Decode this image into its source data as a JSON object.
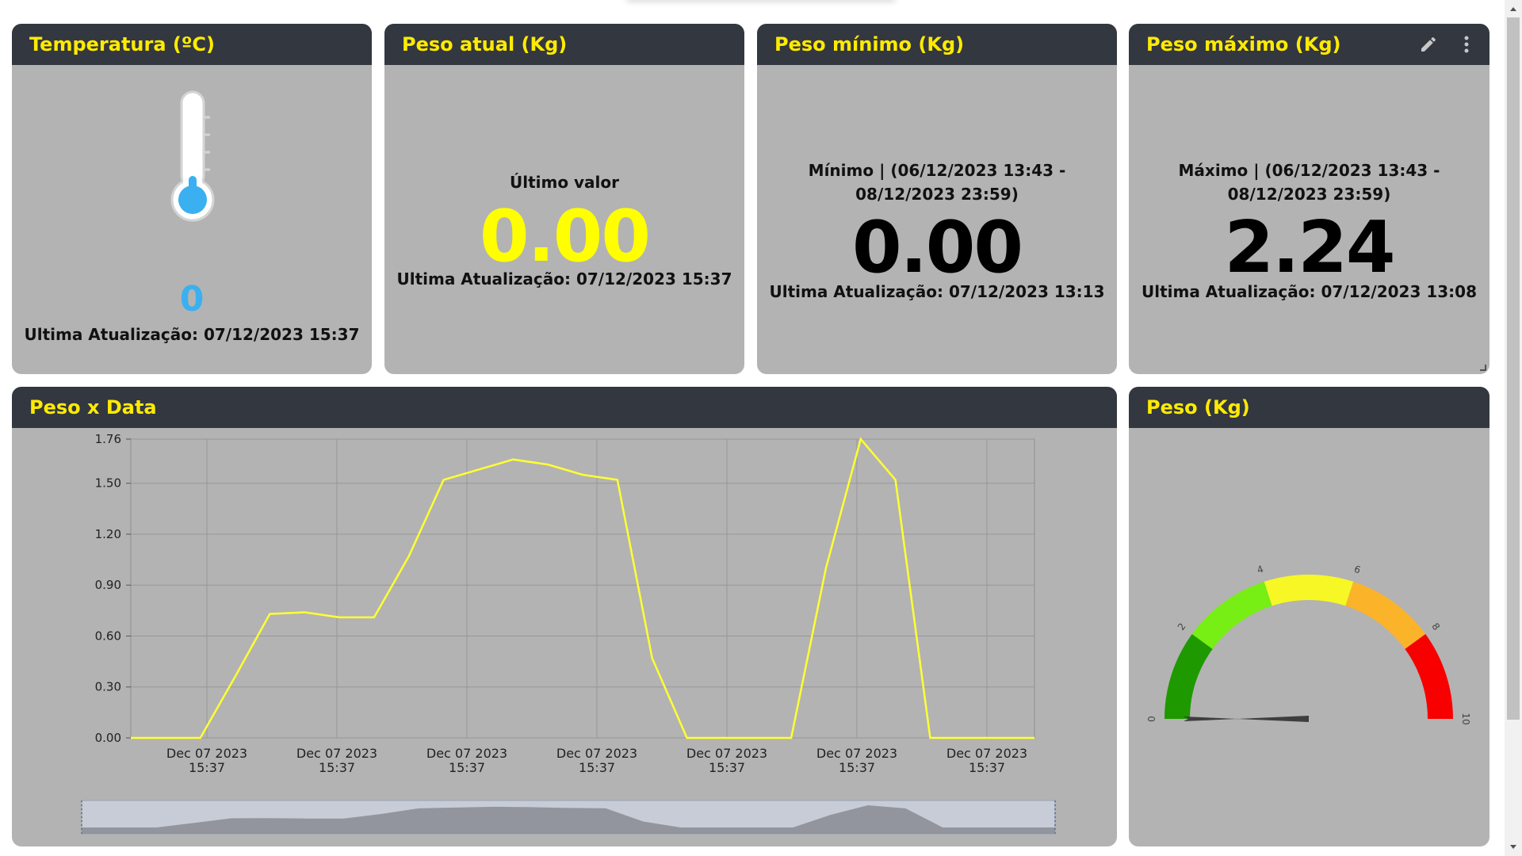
{
  "cards": {
    "temperature": {
      "title": "Temperatura (ºC)",
      "value": "0",
      "updated": "Ultima Atualização: 07/12/2023 15:37"
    },
    "current_weight": {
      "title": "Peso atual (Kg)",
      "caption": "Último valor",
      "value": "0.00",
      "updated": "Ultima Atualização: 07/12/2023 15:37"
    },
    "min_weight": {
      "title": "Peso mínimo (Kg)",
      "range": "Mínimo | (06/12/2023 13:43 - 08/12/2023 23:59)",
      "value": "0.00",
      "updated": "Ultima Atualização: 07/12/2023 13:13"
    },
    "max_weight": {
      "title": "Peso máximo (Kg)",
      "range": "Máximo | (06/12/2023 13:43 - 08/12/2023 23:59)",
      "value": "2.24",
      "updated": "Ultima Atualização: 07/12/2023 13:08",
      "icons": [
        "pencil-icon",
        "more-vertical-icon"
      ]
    },
    "weight_chart": {
      "title": "Peso x Data"
    },
    "gauge": {
      "title": "Peso (Kg)",
      "ticks": [
        "0",
        "2",
        "4",
        "6",
        "8",
        "10"
      ],
      "value": 0.0
    }
  },
  "colors": {
    "header_bg": "#333740",
    "header_text": "#ffeb00",
    "card_bg": "#b3b3b3",
    "accent_yellow": "#ffff00",
    "temp_blue": "#3ab0f0",
    "line": "#ffff33"
  },
  "chart_data": {
    "type": "line",
    "title": "",
    "xlabel": "",
    "ylabel": "",
    "ylim": [
      0,
      1.76
    ],
    "y_ticks": [
      "0.00",
      "0.30",
      "0.60",
      "0.90",
      "1.20",
      "1.50",
      "1.76"
    ],
    "x_ticks": [
      [
        "Dec 07 2023",
        "15:37"
      ],
      [
        "Dec 07 2023",
        "15:37"
      ],
      [
        "Dec 07 2023",
        "15:37"
      ],
      [
        "Dec 07 2023",
        "15:37"
      ],
      [
        "Dec 07 2023",
        "15:37"
      ],
      [
        "Dec 07 2023",
        "15:37"
      ],
      [
        "Dec 07 2023",
        "15:37"
      ]
    ],
    "grid": true,
    "series": [
      {
        "values": [
          0,
          0,
          0,
          0.36,
          0.73,
          0.74,
          0.71,
          0.71,
          1.07,
          1.52,
          1.58,
          1.64,
          1.61,
          1.55,
          1.52,
          0.47,
          0,
          0,
          0,
          0,
          1.0,
          1.76,
          1.52,
          0,
          0,
          0,
          0
        ]
      }
    ]
  }
}
